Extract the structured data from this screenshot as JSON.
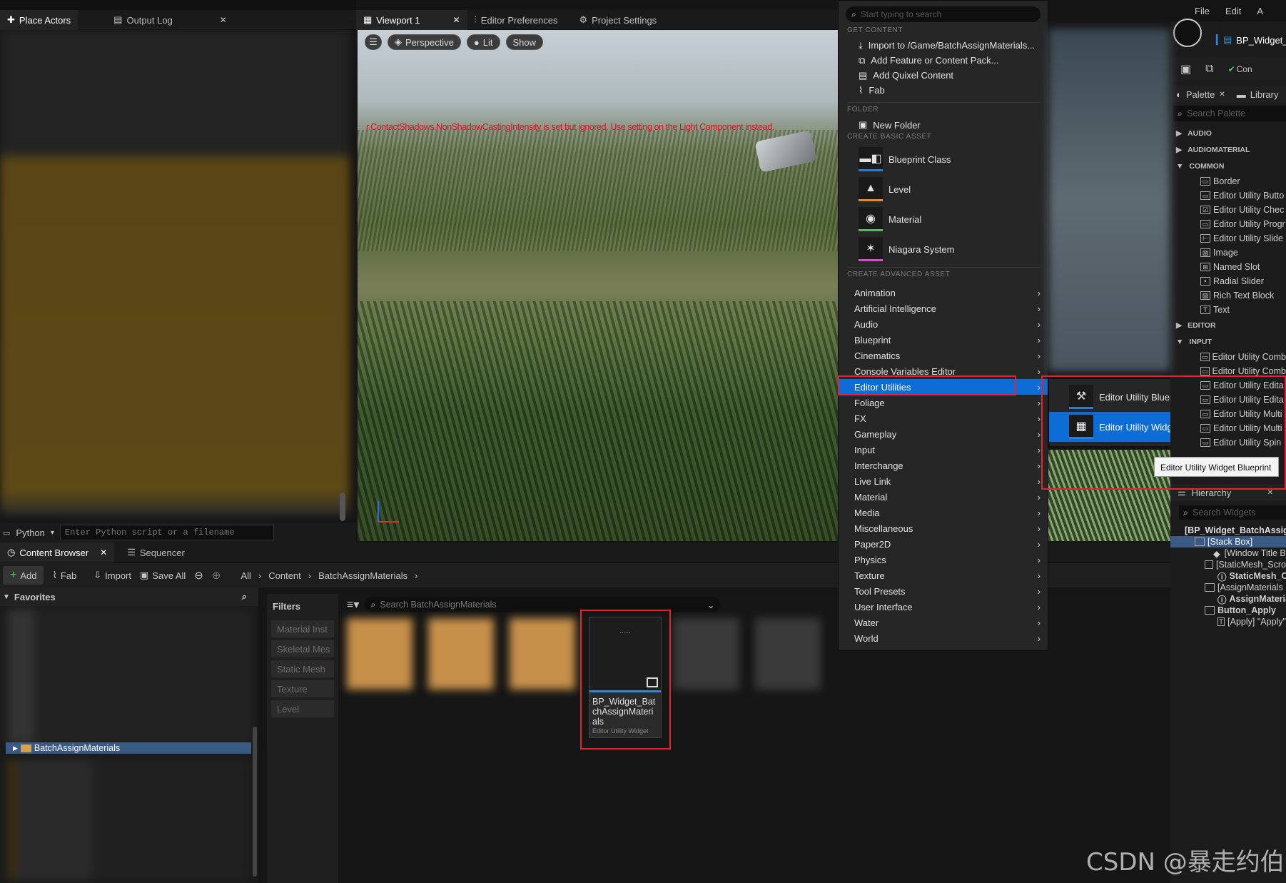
{
  "left_panel": {
    "tabs": [
      {
        "label": "Place Actors"
      },
      {
        "label": "Output Log"
      }
    ],
    "python": {
      "label": "Python",
      "placeholder": "Enter Python script or a filename"
    }
  },
  "viewport": {
    "tabs": [
      {
        "label": "Viewport 1"
      },
      {
        "label": "Editor Preferences"
      },
      {
        "label": "Project Settings"
      }
    ],
    "toolbar": {
      "perspective": "Perspective",
      "lit": "Lit",
      "show": "Show"
    },
    "warning": "r.ContactShadows.NonShadowCastingIntensity is set but ignored. Use setting on the Light Component instead."
  },
  "add_menu": {
    "search_placeholder": "Start typing to search",
    "get_content": {
      "header": "GET CONTENT",
      "items": [
        "Import to /Game/BatchAssignMaterials...",
        "Add Feature or Content Pack...",
        "Add Quixel Content",
        "Fab"
      ]
    },
    "folder": {
      "header": "FOLDER",
      "items": [
        "New Folder"
      ]
    },
    "basic": {
      "header": "CREATE BASIC ASSET",
      "items": [
        {
          "label": "Blueprint Class",
          "color": "#2e7bd6"
        },
        {
          "label": "Level",
          "color": "#e48a2c"
        },
        {
          "label": "Material",
          "color": "#5cb85c"
        },
        {
          "label": "Niagara System",
          "color": "#d84cd2"
        }
      ]
    },
    "advanced": {
      "header": "CREATE ADVANCED ASSET",
      "items": [
        "Animation",
        "Artificial Intelligence",
        "Audio",
        "Blueprint",
        "Cinematics",
        "Console Variables Editor",
        "Editor Utilities",
        "Foliage",
        "FX",
        "Gameplay",
        "Input",
        "Interchange",
        "Live Link",
        "Material",
        "Media",
        "Miscellaneous",
        "Paper2D",
        "Physics",
        "Texture",
        "Tool Presets",
        "User Interface",
        "Water",
        "World"
      ]
    },
    "highlight_color": "#0e6cd6"
  },
  "submenu": {
    "items": [
      "Editor Utility Blueprint",
      "Editor Utility Widget"
    ],
    "tooltip": "Editor Utility Widget Blueprint"
  },
  "content_browser": {
    "tabs": [
      {
        "label": "Content Browser"
      },
      {
        "label": "Sequencer"
      }
    ],
    "toolbar": {
      "add": "Add",
      "fab": "Fab",
      "import": "Import",
      "save_all": "Save All"
    },
    "breadcrumb": [
      "All",
      "Content",
      "BatchAssignMaterials"
    ],
    "favorites": "Favorites",
    "folder": "BatchAssignMaterials",
    "filters_title": "Filters",
    "filters": [
      "Material Inst",
      "Skeletal Mes",
      "Static Mesh",
      "Texture",
      "Level"
    ],
    "search_placeholder": "Search BatchAssignMaterials",
    "asset": {
      "name": "BP_Widget_BatchAssignMaterials",
      "type": "Editor Utility Widget",
      "thumb_label": "......"
    }
  },
  "widget_editor": {
    "menu": [
      "File",
      "Edit",
      "A"
    ],
    "asset_tab": "BP_Widget_",
    "compile_label": "Con",
    "palette_tab": "Palette",
    "library_tab": "Library",
    "palette_search": "Search Palette",
    "sections": {
      "audio": "AUDIO",
      "audiomaterial": "AUDIOMATERIAL",
      "common": "COMMON",
      "editor": "EDITOR",
      "input": "INPUT"
    },
    "common_items": [
      "Border",
      "Editor Utility Butto",
      "Editor Utility Chec",
      "Editor Utility Progr",
      "Editor Utility Slide",
      "Image",
      "Named Slot",
      "Radial Slider",
      "Rich Text Block",
      "Text"
    ],
    "input_items": [
      "Editor Utility Comb",
      "Editor Utility Comb",
      "Editor Utility Edita",
      "Editor Utility Edita",
      "Editor Utility Multi",
      "Editor Utility Multi",
      "Editor Utility Spin"
    ],
    "hierarchy_tab": "Hierarchy",
    "hierarchy_search": "Search Widgets",
    "tree": [
      "[BP_Widget_BatchAssig",
      "[Stack Box]",
      "[Window Title Bar",
      "[StaticMesh_Scro",
      "StaticMesh_Car",
      "[AssignMaterials",
      "AssignMaterials",
      "Button_Apply",
      "[Apply] \"Apply\""
    ]
  },
  "watermark": "CSDN @暴走约伯"
}
